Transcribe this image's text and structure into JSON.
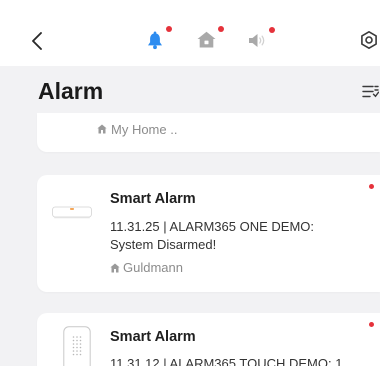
{
  "nav": {
    "back_icon": "chevron-left-icon",
    "tabs": [
      {
        "icon": "bell-icon",
        "selected": true,
        "has_badge": true
      },
      {
        "icon": "home-icon",
        "selected": false,
        "has_badge": true
      },
      {
        "icon": "speaker-icon",
        "selected": false,
        "has_badge": true
      }
    ],
    "settings_icon": "gear-icon"
  },
  "header": {
    "title": "Alarm",
    "filter_icon": "filter-list-icon"
  },
  "cards": [
    {
      "location_icon": "home-icon",
      "location": "My Home .."
    },
    {
      "device_icon": "smart-alarm-hub-icon",
      "device_name": "Smart Alarm",
      "message": "11.31.25 | ALARM365 ONE DEMO: System Disarmed!",
      "location_icon": "home-icon",
      "location": "Guldmann",
      "unread": true
    },
    {
      "device_icon": "keypad-icon",
      "device_name": "Smart Alarm",
      "message": "11.31.12 | ALARM365 TOUCH DEMO: 1",
      "unread": true
    }
  ],
  "colors": {
    "accent": "#2d8cf0",
    "badge": "#e5323b",
    "inactive_icon": "#a9a9a9",
    "background": "#f2f2f4",
    "card": "#ffffff",
    "text": "#222222",
    "muted_text": "#8c8c8c"
  }
}
